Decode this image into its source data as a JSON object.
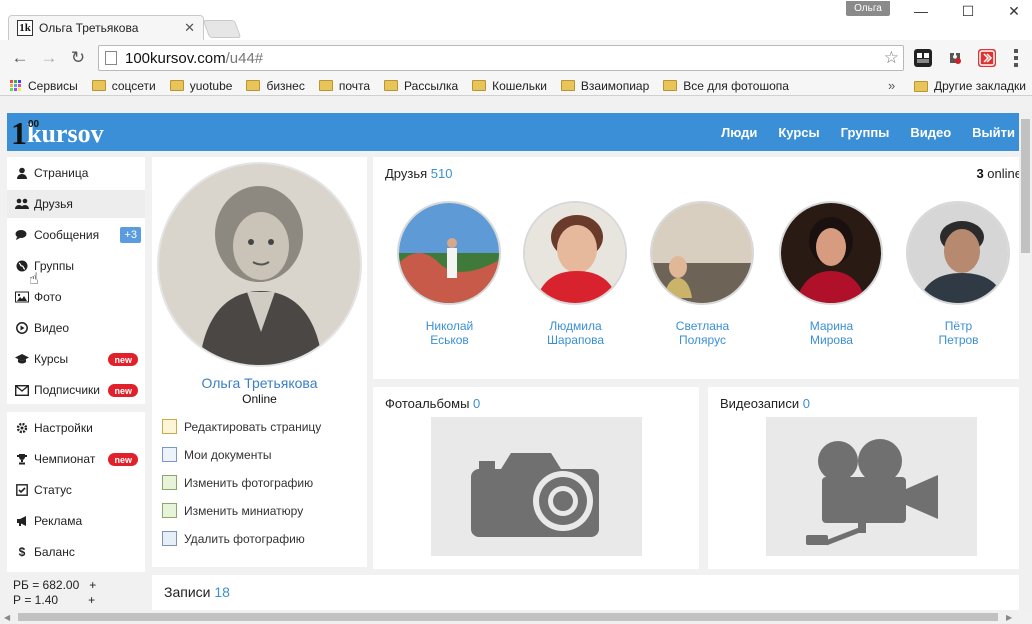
{
  "browser": {
    "tab_title": "Ольга Третьякова",
    "tab_favicon": "1k",
    "user_badge": "Ольга",
    "url_host": "100kursov.com",
    "url_path": "/u44#",
    "window_buttons": {
      "minimize": "—",
      "maximize": "☐",
      "close": "✕"
    },
    "bookmarks": [
      "Сервисы",
      "соцсети",
      "yuotube",
      "бизнес",
      "почта",
      "Рассылка",
      "Кошельки",
      "Взаимопиар",
      "Все для фотошопа"
    ],
    "bookmarks_more": "»",
    "other_bookmarks": "Другие закладки"
  },
  "site": {
    "logo_one": "1",
    "logo_oo": "00",
    "logo_text": "kursov",
    "nav": [
      "Люди",
      "Курсы",
      "Группы",
      "Видео",
      "Выйти"
    ]
  },
  "sidebar": {
    "items": [
      {
        "label": "Страница",
        "icon": "user-icon"
      },
      {
        "label": "Друзья",
        "icon": "friends-icon"
      },
      {
        "label": "Сообщения",
        "icon": "messages-icon",
        "count": "+3"
      },
      {
        "label": "Группы",
        "icon": "globe-icon"
      },
      {
        "label": "Фото",
        "icon": "photo-icon"
      },
      {
        "label": "Видео",
        "icon": "play-icon"
      },
      {
        "label": "Курсы",
        "icon": "graduation-cap-icon",
        "badge": "new"
      },
      {
        "label": "Подписчики",
        "icon": "envelope-icon",
        "badge": "new"
      }
    ],
    "items2": [
      {
        "label": "Настройки",
        "icon": "gear-icon"
      },
      {
        "label": "Чемпионат",
        "icon": "trophy-icon",
        "badge": "new"
      },
      {
        "label": "Статус",
        "icon": "check-icon"
      },
      {
        "label": "Реклама",
        "icon": "megaphone-icon"
      },
      {
        "label": "Баланс",
        "icon": "dollar-icon"
      }
    ],
    "balance_rb": "РБ = 682.00",
    "balance_r": "Р = 1.40",
    "plus": "+"
  },
  "profile": {
    "name": "Ольга Третьякова",
    "status": "Online",
    "actions": [
      "Редактировать страницу",
      "Мои документы",
      "Изменить фотографию",
      "Изменить миниатюру",
      "Удалить фотографию"
    ]
  },
  "friends": {
    "title": "Друзья",
    "count": "510",
    "online_num": "3",
    "online_word": "online",
    "list": [
      {
        "first": "Николай",
        "last": "Еськов"
      },
      {
        "first": "Людмила",
        "last": "Шарапова"
      },
      {
        "first": "Светлана",
        "last": "Полярус"
      },
      {
        "first": "Марина",
        "last": "Мирова"
      },
      {
        "first": "Пётр",
        "last": "Петров"
      }
    ]
  },
  "albums": {
    "title": "Фотоальбомы",
    "count": "0"
  },
  "videos": {
    "title": "Видеозаписи",
    "count": "0"
  },
  "posts": {
    "title": "Записи",
    "count": "18"
  },
  "colors": {
    "header_blue": "#3a8fd6",
    "link_blue": "#3a8fd6",
    "badge_red": "#e0212b",
    "count_blue": "#5b9be0"
  }
}
